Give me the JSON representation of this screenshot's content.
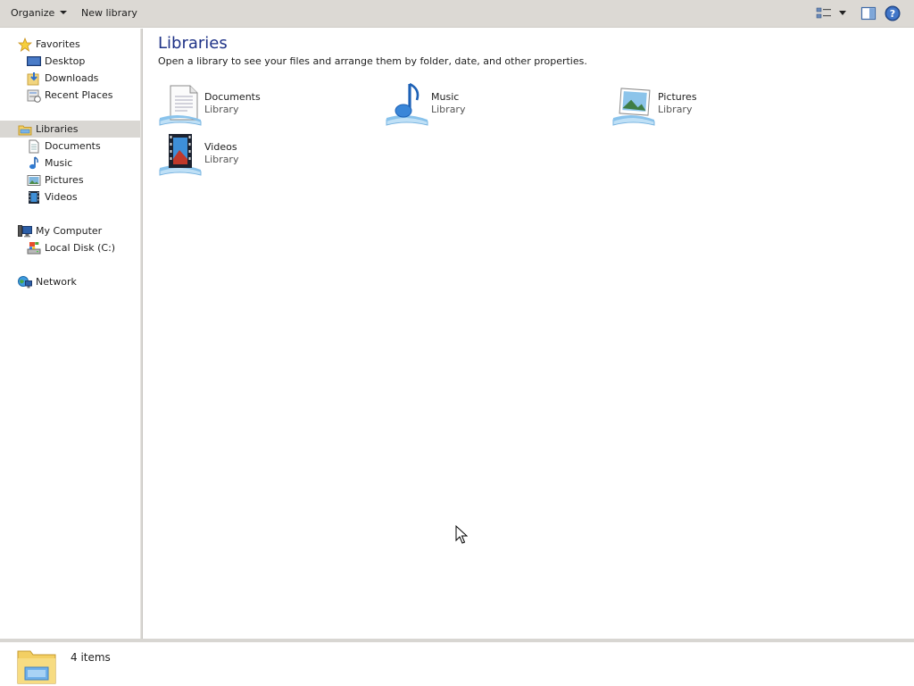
{
  "toolbar": {
    "organize_label": "Organize",
    "new_library_label": "New library"
  },
  "sidebar": {
    "favorites": {
      "label": "Favorites",
      "items": [
        {
          "label": "Desktop",
          "icon": "desktop-icon"
        },
        {
          "label": "Downloads",
          "icon": "downloads-icon"
        },
        {
          "label": "Recent Places",
          "icon": "recent-places-icon"
        }
      ]
    },
    "libraries": {
      "label": "Libraries",
      "selected": true,
      "items": [
        {
          "label": "Documents",
          "icon": "documents-icon"
        },
        {
          "label": "Music",
          "icon": "music-icon"
        },
        {
          "label": "Pictures",
          "icon": "pictures-icon"
        },
        {
          "label": "Videos",
          "icon": "videos-icon"
        }
      ]
    },
    "computer": {
      "label": "My Computer",
      "items": [
        {
          "label": "Local Disk (C:)",
          "icon": "local-disk-icon"
        }
      ]
    },
    "network": {
      "label": "Network"
    }
  },
  "main": {
    "title": "Libraries",
    "subtitle": "Open a library to see your files and arrange them by folder, date, and other properties.",
    "libraries": [
      {
        "name": "Documents",
        "type": "Library",
        "icon": "documents-library-icon"
      },
      {
        "name": "Music",
        "type": "Library",
        "icon": "music-library-icon"
      },
      {
        "name": "Pictures",
        "type": "Library",
        "icon": "pictures-library-icon"
      },
      {
        "name": "Videos",
        "type": "Library",
        "icon": "videos-library-icon"
      }
    ]
  },
  "status": {
    "item_count": "4 items"
  },
  "colors": {
    "toolbar_bg": "#dcd9d4",
    "selected_bg": "#d9d7d3",
    "title_color": "#1e3287"
  }
}
